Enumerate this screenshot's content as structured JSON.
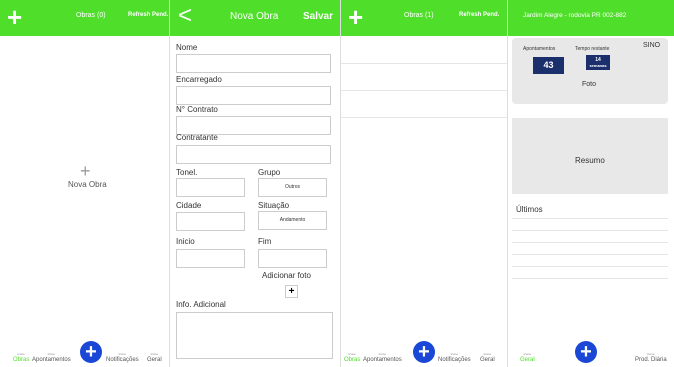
{
  "colors": {
    "accent": "#4fde2a",
    "fab": "#1a47d6",
    "navy": "#1a2f6b"
  },
  "screen1": {
    "title": "Obras (0)",
    "refresh": "Refresh Pend.",
    "nova_obra": "Nova Obra",
    "nav": {
      "obras": "Obras",
      "apontamentos": "Apontamentos",
      "notificacoes": "Notificações",
      "geral": "Geral",
      "tiny": "Icone"
    }
  },
  "screen2": {
    "title": "Nova Obra",
    "save": "Salvar",
    "labels": {
      "nome": "Nome",
      "encarregado": "Encarregado",
      "contrato": "N° Contrato",
      "contratante": "Contratante",
      "tonel": "Tonel.",
      "grupo": "Grupo",
      "cidade": "Cidade",
      "situacao": "Situação",
      "inicio": "Inicio",
      "fim": "Fim",
      "adicionar_foto": "Adicionar foto",
      "info_adicional": "Info. Adicional"
    },
    "selects": {
      "grupo": "Outros",
      "situacao": "Andamento"
    }
  },
  "screen3": {
    "title": "Obras (1)",
    "refresh": "Refresh Pend.",
    "nav": {
      "obras": "Obras",
      "apontamentos": "Apontamentos",
      "notificacoes": "Notificações",
      "geral": "Geral",
      "tiny": "Icone"
    }
  },
  "screen4": {
    "title": "Jardim Alegre - rodovia PR 002-882",
    "apontamentos_label": "Apontamentos",
    "tempo_label": "Tempo restante",
    "sino": "SINO",
    "apontamentos_value": "43",
    "tempo_value": "14",
    "tempo_unit": "semanas",
    "foto": "Foto",
    "resumo": "Resumo",
    "ultimos": "Últimos",
    "nav": {
      "geral": "Geral",
      "prod": "Prod. Diária",
      "tiny": "Icone"
    }
  }
}
